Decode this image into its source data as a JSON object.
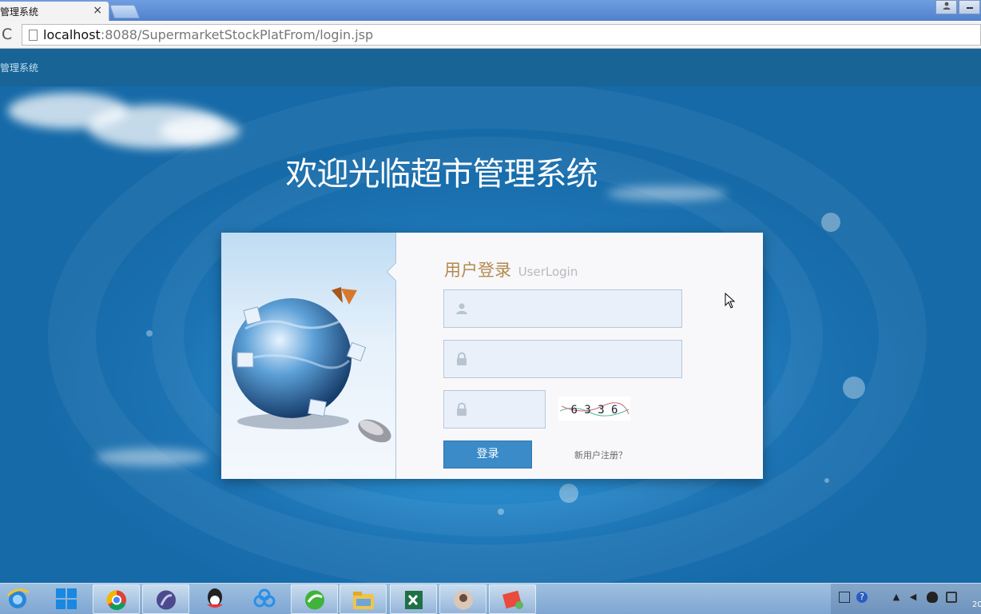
{
  "browser": {
    "tab_title": "管理系统",
    "tab_close": "×",
    "url_host": "localhost",
    "url_path": ":8088/SupermarketStockPlatFrom/login.jsp",
    "reload_glyph": "C"
  },
  "page": {
    "site_name": "管理系统",
    "welcome": "欢迎光临超市管理系统"
  },
  "login": {
    "title": "用户登录",
    "subtitle": "UserLogin",
    "username_value": "",
    "password_value": "",
    "captcha_value": "",
    "captcha_text": "6 3 3 6",
    "submit_label": "登录",
    "register_label": "新用户注册？"
  },
  "taskbar": {
    "clock": "20",
    "apps": [
      "ie-icon",
      "start-metro-icon",
      "chrome-icon",
      "eclipse-icon",
      "qq-icon",
      "baidu-cloud-icon",
      "360-icon",
      "file-explorer-icon",
      "excel-icon",
      "photo-icon",
      "notes-icon"
    ]
  },
  "colors": {
    "accent": "#3a8bc8",
    "title_gold": "#b28a4d",
    "background": "#1e75ae"
  }
}
